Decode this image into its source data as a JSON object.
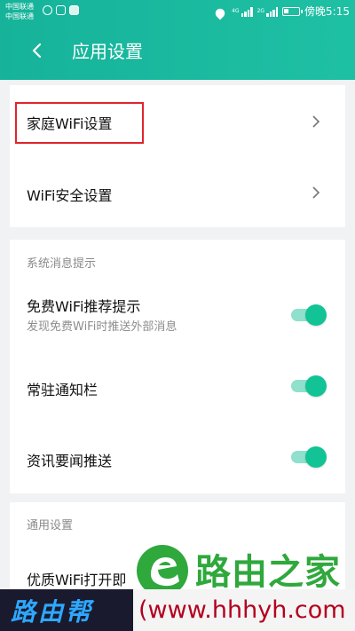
{
  "status_bar": {
    "carrier_1": "中国联通",
    "carrier_2": "中国联通",
    "network_tag_1": "4G",
    "network_tag_2": "2G",
    "battery_level": 0.35,
    "time": "傍晚5:15"
  },
  "header": {
    "title": "应用设置",
    "back_icon": "chevron-left-icon",
    "gradient_start": "#16b39a",
    "gradient_end": "#1ec0a4"
  },
  "card_wifi": {
    "items": [
      {
        "label": "家庭WiFi设置",
        "icon": "chevron-right-icon",
        "highlighted": true
      },
      {
        "label": "WiFi安全设置",
        "icon": "chevron-right-icon"
      }
    ]
  },
  "card_notifications": {
    "section_title": "系统消息提示",
    "items": [
      {
        "label": "免费WiFi推荐提示",
        "sublabel": "发现免费WiFi时推送外部消息",
        "enabled": true
      },
      {
        "label": "常驻通知栏",
        "enabled": true
      },
      {
        "label": "资讯要闻推送",
        "enabled": true
      }
    ]
  },
  "card_general": {
    "section_title": "通用设置",
    "items": [
      {
        "label": "优质WiFi打开即"
      }
    ]
  },
  "watermark": {
    "brand_cn": "路由之家",
    "left_text": "路由帮",
    "url_text": "(www.hhhyh.com",
    "brand_color": "#2fa83c",
    "highlight_color": "#e0252b",
    "toggle_color": "#12c395"
  }
}
